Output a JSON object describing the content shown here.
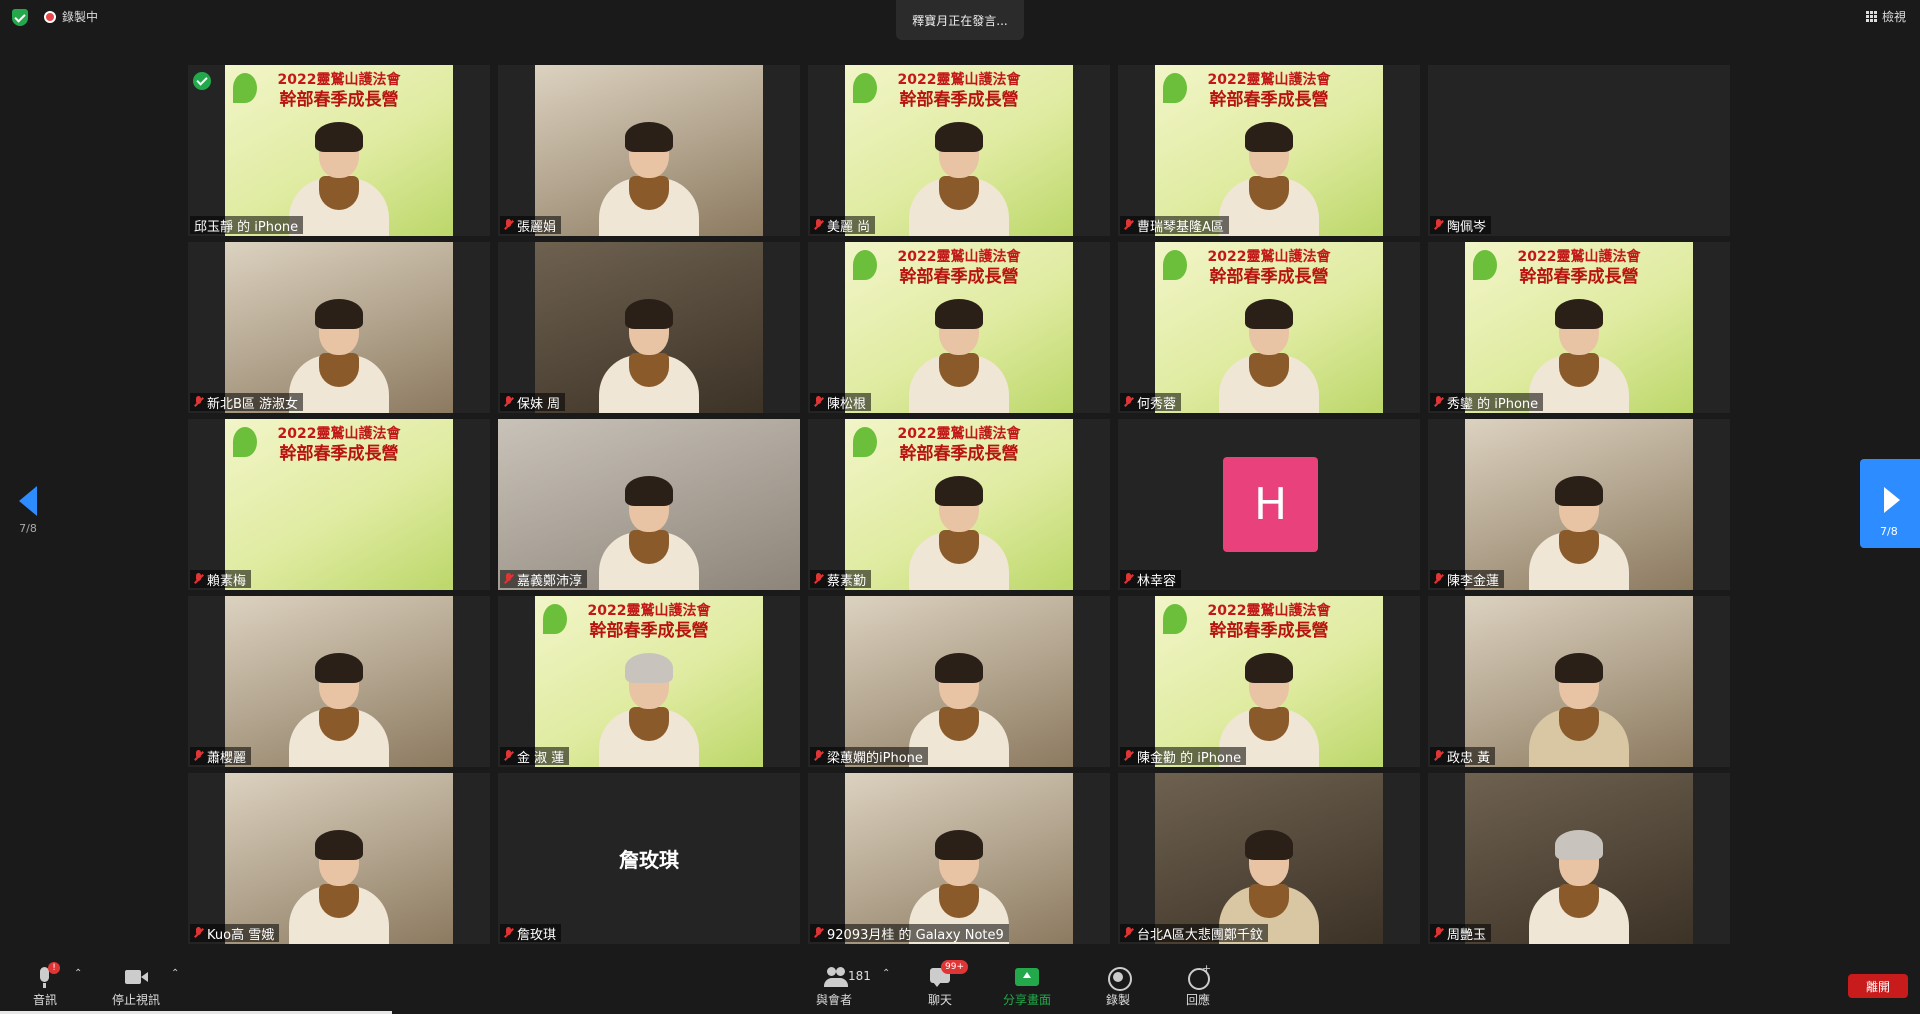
{
  "topbar": {
    "recording_label": "錄製中",
    "speaking_text": "釋寶月正在發言...",
    "view_label": "檢視"
  },
  "banner": {
    "line1": "2022靈鷲山護法會",
    "line2": "幹部春季成長營"
  },
  "pager": {
    "left_text": "7/8",
    "right_text": "7/8"
  },
  "participants": [
    {
      "name": "邱玉靜 的 iPhone",
      "muted": false,
      "active": true,
      "video": "banner"
    },
    {
      "name": "張麗娟",
      "muted": true,
      "video": "room"
    },
    {
      "name": "美麗 尚",
      "muted": true,
      "video": "banner"
    },
    {
      "name": "曹瑞琴基隆A區",
      "muted": true,
      "video": "banner"
    },
    {
      "name": "陶佩岑",
      "muted": true,
      "video": "none"
    },
    {
      "name": "新北B區 游淑女",
      "muted": true,
      "video": "room"
    },
    {
      "name": "保妹 周",
      "muted": true,
      "video": "dark"
    },
    {
      "name": "陳松根",
      "muted": true,
      "video": "banner"
    },
    {
      "name": "何秀蓉",
      "muted": true,
      "video": "banner"
    },
    {
      "name": "秀鑾 的 iPhone",
      "muted": true,
      "video": "banner"
    },
    {
      "name": "賴素梅",
      "muted": true,
      "video": "banner"
    },
    {
      "name": "嘉義鄭沛淳",
      "muted": true,
      "video": "gray"
    },
    {
      "name": "蔡素勤",
      "muted": true,
      "video": "banner"
    },
    {
      "name": "林幸容",
      "muted": true,
      "video": "avatar",
      "avatar_letter": "H"
    },
    {
      "name": "陳李金蓮",
      "muted": true,
      "video": "room"
    },
    {
      "name": "蕭櫻麗",
      "muted": true,
      "video": "room"
    },
    {
      "name": "金 淑 蓮",
      "muted": true,
      "video": "banner"
    },
    {
      "name": "梁蕙嫻的iPhone",
      "muted": true,
      "video": "room"
    },
    {
      "name": "陳金勸 的 iPhone",
      "muted": true,
      "video": "banner"
    },
    {
      "name": "政忠 黃",
      "muted": true,
      "video": "room"
    },
    {
      "name": "Kuo高 雪娥",
      "muted": true,
      "video": "room"
    },
    {
      "name": "詹玫琪",
      "muted": true,
      "video": "name",
      "display_name": "詹玫琪"
    },
    {
      "name": "92093月桂 的 Galaxy Note9",
      "muted": true,
      "video": "room"
    },
    {
      "name": "台北A區大悲團鄭千鈫",
      "muted": true,
      "video": "dark"
    },
    {
      "name": "周艷玉",
      "muted": true,
      "video": "dark"
    }
  ],
  "toolbar": {
    "audio_label": "音訊",
    "audio_badge": "!",
    "video_label": "停止視訊",
    "participants_label": "與會者",
    "participants_count": "181",
    "chat_label": "聊天",
    "chat_badge": "99+",
    "share_label": "分享畫面",
    "record_label": "錄製",
    "reactions_label": "回應",
    "leave_label": "離開"
  },
  "colors": {
    "accent": "#2d8cff",
    "leave": "#c81c1c",
    "share": "#23a94b",
    "avatar_h": "#e8417c",
    "muted_icon": "#e03535"
  }
}
